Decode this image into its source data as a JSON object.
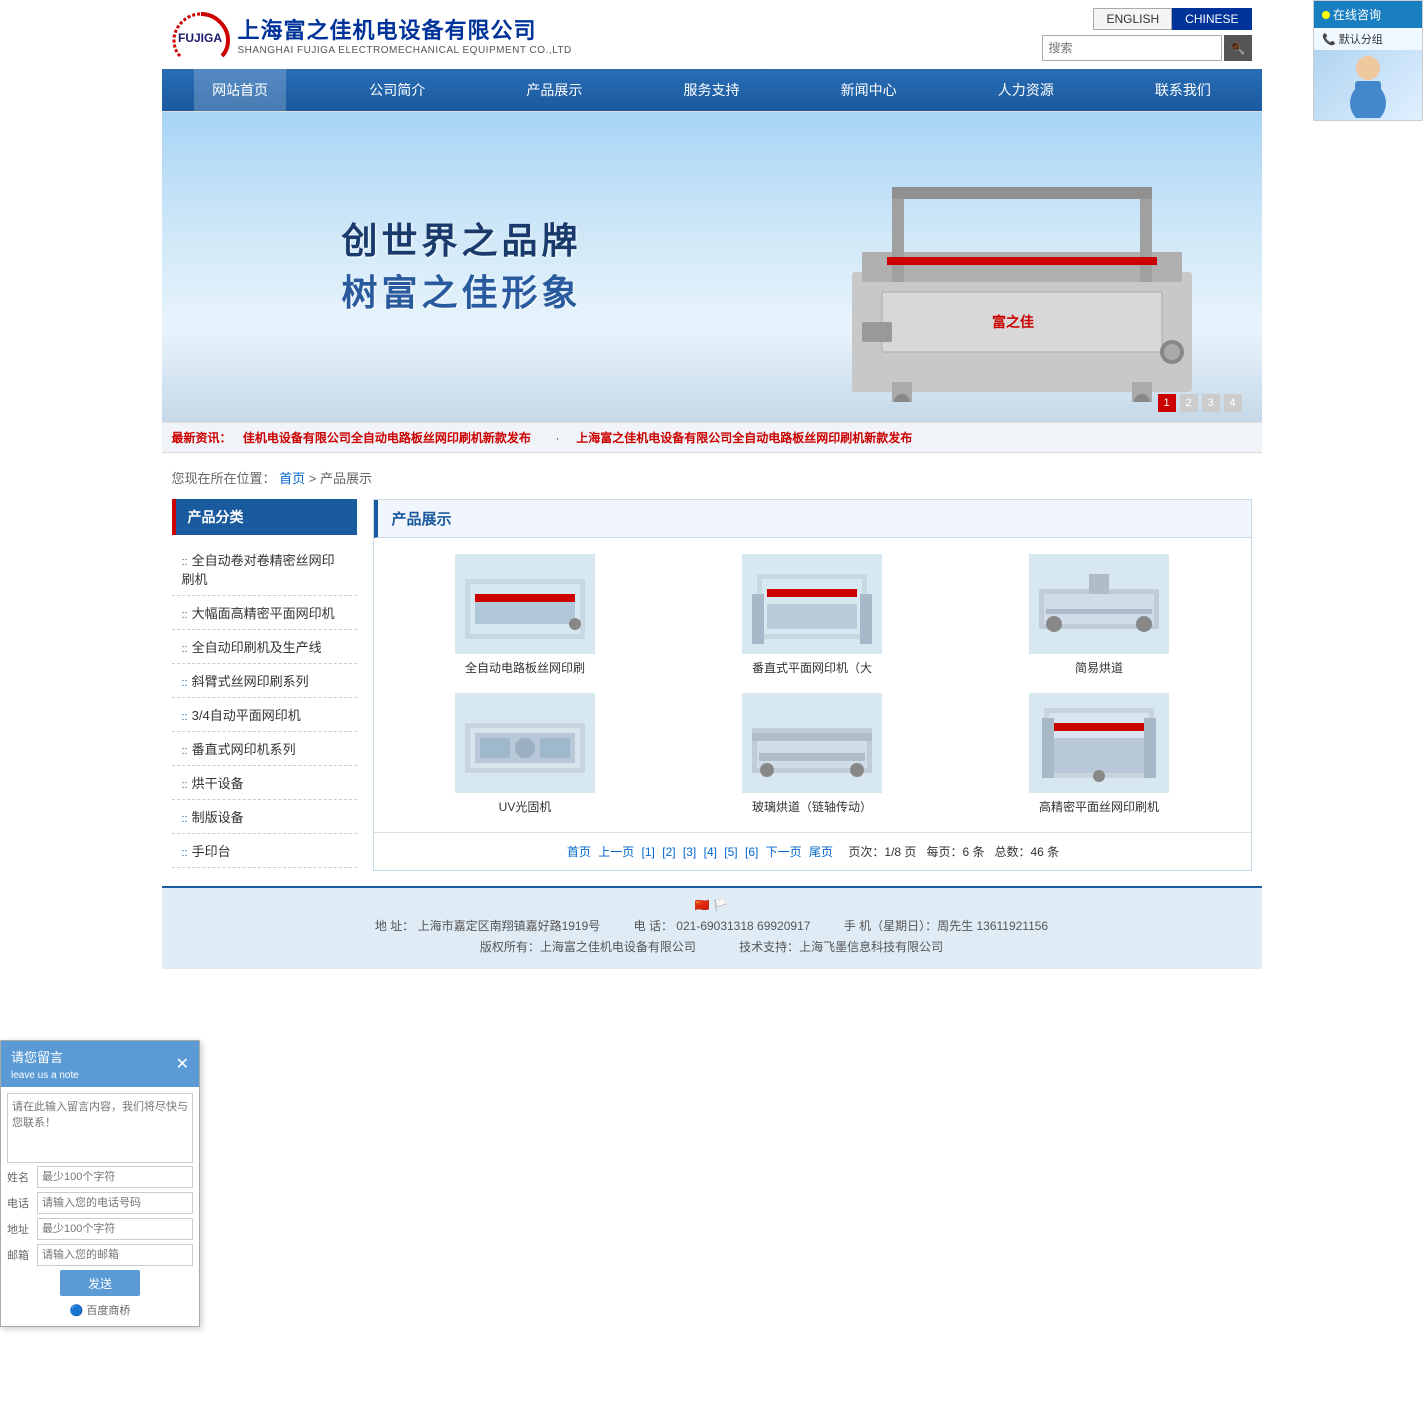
{
  "header": {
    "logo_cn": "上海富之佳机电设备有限公司",
    "logo_en": "SHANGHAI FUJIGA ELECTROMECHANICAL EQUIPMENT CO.,LTD",
    "lang_english": "ENGLISH",
    "lang_chinese": "CHINESE",
    "search_placeholder": "搜索"
  },
  "consult": {
    "label": "在线咨询",
    "sub": "默认分组"
  },
  "nav": {
    "items": [
      {
        "label": "网站首页",
        "active": true
      },
      {
        "label": "公司简介"
      },
      {
        "label": "产品展示"
      },
      {
        "label": "服务支持"
      },
      {
        "label": "新闻中心"
      },
      {
        "label": "人力资源"
      },
      {
        "label": "联系我们"
      }
    ]
  },
  "banner": {
    "slogan1": "创世界之品牌",
    "slogan2": "树富之佳形象",
    "indicators": [
      "1",
      "2",
      "3",
      "4"
    ]
  },
  "news": {
    "label": "最新资讯：",
    "items": [
      "佳机电设备有限公司全自动电路板丝网印刷机新款发布",
      "上海富之佳机电设备有限公司全自动电路板丝网印刷机新款发布"
    ]
  },
  "breadcrumb": {
    "home": "首页",
    "separator": " > ",
    "current": "产品展示"
  },
  "sidebar": {
    "title": "产品分类",
    "items": [
      "全自动卷对卷精密丝网印刷机",
      "大幅面高精密平面网印机",
      "全自动印刷机及生产线",
      "斜臂式丝网印刷系列",
      "3/4自动平面网印机",
      "番直式网印机系列",
      "烘干设备",
      "制版设备",
      "手印台"
    ]
  },
  "product_area": {
    "title": "产品展示",
    "products": [
      {
        "name": "全自动电路板丝网印刷"
      },
      {
        "name": "番直式平面网印机（大"
      },
      {
        "name": "简易烘道"
      },
      {
        "name": "UV光固机"
      },
      {
        "name": "玻璃烘道（链轴传动）"
      },
      {
        "name": "高精密平面丝网印刷机"
      }
    ],
    "pagination": {
      "first": "首页",
      "prev": "上一页",
      "pages": [
        "[1]",
        "[2]",
        "[3]",
        "[4]",
        "[5]",
        "[6]"
      ],
      "next": "下一页",
      "last": "尾页",
      "current_info": "页次：1/8 页",
      "per_page": "每页：6 条",
      "total": "总数：46 条"
    }
  },
  "leave_msg": {
    "title": "请您留言",
    "subtitle": "leave us a note",
    "textarea_placeholder": "请在此输入留言内容，我们将尽快与您联系！",
    "name_label": "姓名",
    "name_placeholder": "最少100个字符",
    "phone_label": "电话",
    "phone_placeholder": "请输入您的电话号码",
    "address_label": "地址",
    "address_placeholder": "最少100个字符",
    "email_label": "邮箱",
    "email_placeholder": "请输入您的邮箱",
    "send_btn": "发送",
    "baidu_label": "百度商桥"
  },
  "footer": {
    "address_label": "地  址：",
    "address_value": "上海市嘉定区南翔镇嘉好路1919号",
    "phone_label": "电  话：",
    "phone_value": "021-69031318  69920917",
    "mobile_label": "手  机（星期日）：周先生",
    "mobile_value": "13611921156",
    "copyright": "版权所有：上海富之佳机电设备有限公司",
    "support": "技术支持：上海飞墨信息科技有限公司"
  }
}
